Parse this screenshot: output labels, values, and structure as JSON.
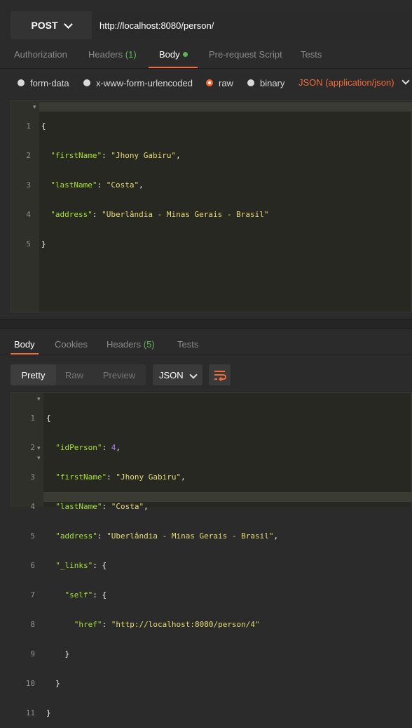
{
  "request": {
    "method": "POST",
    "url": "http://localhost:8080/person/"
  },
  "request_tabs": {
    "authorization": "Authorization",
    "headers": "Headers",
    "headers_count": "(1)",
    "body": "Body",
    "prerequest": "Pre-request Script",
    "tests": "Tests"
  },
  "body_modes": {
    "form_data": "form-data",
    "urlencoded": "x-www-form-urlencoded",
    "raw": "raw",
    "binary": "binary",
    "content_type": "JSON (application/json)"
  },
  "request_body": {
    "line_numbers": [
      "1",
      "2",
      "3",
      "4",
      "5"
    ],
    "l1": "{",
    "l2_key": "\"firstName\"",
    "l2_val": "\"Jhony Gabiru\"",
    "l3_key": "\"lastName\"",
    "l3_val": "\"Costa\"",
    "l4_key": "\"address\"",
    "l4_val": "\"Uberlândia - Minas Gerais - Brasil\"",
    "l5": "}"
  },
  "response_tabs": {
    "body": "Body",
    "cookies": "Cookies",
    "headers": "Headers",
    "headers_count": "(5)",
    "tests": "Tests"
  },
  "response_view": {
    "pretty": "Pretty",
    "raw": "Raw",
    "preview": "Preview",
    "format": "JSON"
  },
  "response_body": {
    "line_numbers": [
      "1",
      "2",
      "3",
      "4",
      "5",
      "6",
      "7",
      "8",
      "9",
      "10",
      "11"
    ],
    "l1": "{",
    "l2_key": "\"idPerson\"",
    "l2_val": "4",
    "l3_key": "\"firstName\"",
    "l3_val": "\"Jhony Gabiru\"",
    "l4_key": "\"lastName\"",
    "l4_val": "\"Costa\"",
    "l5_key": "\"address\"",
    "l5_val": "\"Uberlândia - Minas Gerais - Brasil\"",
    "l6_key": "\"_links\"",
    "l7_key": "\"self\"",
    "l8_key": "\"href\"",
    "l8_val": "\"http://localhost:8080/person/4\"",
    "l9": "}",
    "l10": "}",
    "l11": "}"
  },
  "colors": {
    "accent": "#f26b3a",
    "count_green": "#5fb157",
    "key": "#a6e22e",
    "string": "#e6db74",
    "number": "#ae81ff"
  },
  "icons": [
    "chevron-down-icon",
    "wrap-lines-icon",
    "fold-arrow-icon"
  ]
}
